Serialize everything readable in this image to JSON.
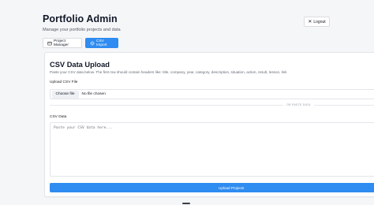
{
  "header": {
    "title": "Portfolio Admin",
    "subtitle": "Manage your portfolio projects and data",
    "logout_label": "Logout",
    "logout_icon": "close-icon"
  },
  "tabs": [
    {
      "label": "Project Manager",
      "icon": "folder-icon",
      "active": false
    },
    {
      "label": "CSV Import",
      "icon": "gear-icon",
      "active": true
    }
  ],
  "upload": {
    "title": "CSV Data Upload",
    "description": "Paste your CSV data below. The first row should contain headers like: title, company, year, category, description, situation, action, result, lesson, link",
    "file_label": "Upload CSV File",
    "choose_file_label": "Choose file",
    "no_file_text": "No file chosen",
    "or_paste_text": "OR PASTE DATA",
    "csv_label": "CSV Data",
    "csv_placeholder": "Paste your CSV data here...",
    "csv_value": "",
    "submit_label": "Upload Projects"
  },
  "colors": {
    "accent": "#2f8cf0",
    "background": "#f5f6f8",
    "card": "#ffffff"
  }
}
